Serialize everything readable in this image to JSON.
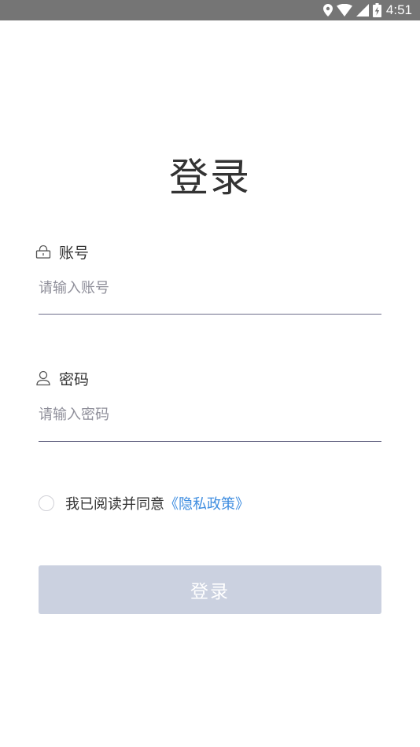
{
  "status_bar": {
    "time": "4:51",
    "icons": [
      "location-icon",
      "wifi-icon",
      "cell-signal-icon",
      "battery-icon"
    ],
    "background": "#757575"
  },
  "login": {
    "title": "登录",
    "account": {
      "label": "账号",
      "icon": "lock-icon",
      "placeholder": "请输入账号",
      "value": ""
    },
    "password": {
      "label": "密码",
      "icon": "user-icon",
      "placeholder": "请输入密码",
      "value": ""
    },
    "agreement": {
      "checked": false,
      "text": "我已阅读并同意",
      "link_text": "《隐私政策》",
      "link_color": "#3e8de0"
    },
    "submit_label": "登录",
    "submit_color": "#cbd1e0"
  }
}
